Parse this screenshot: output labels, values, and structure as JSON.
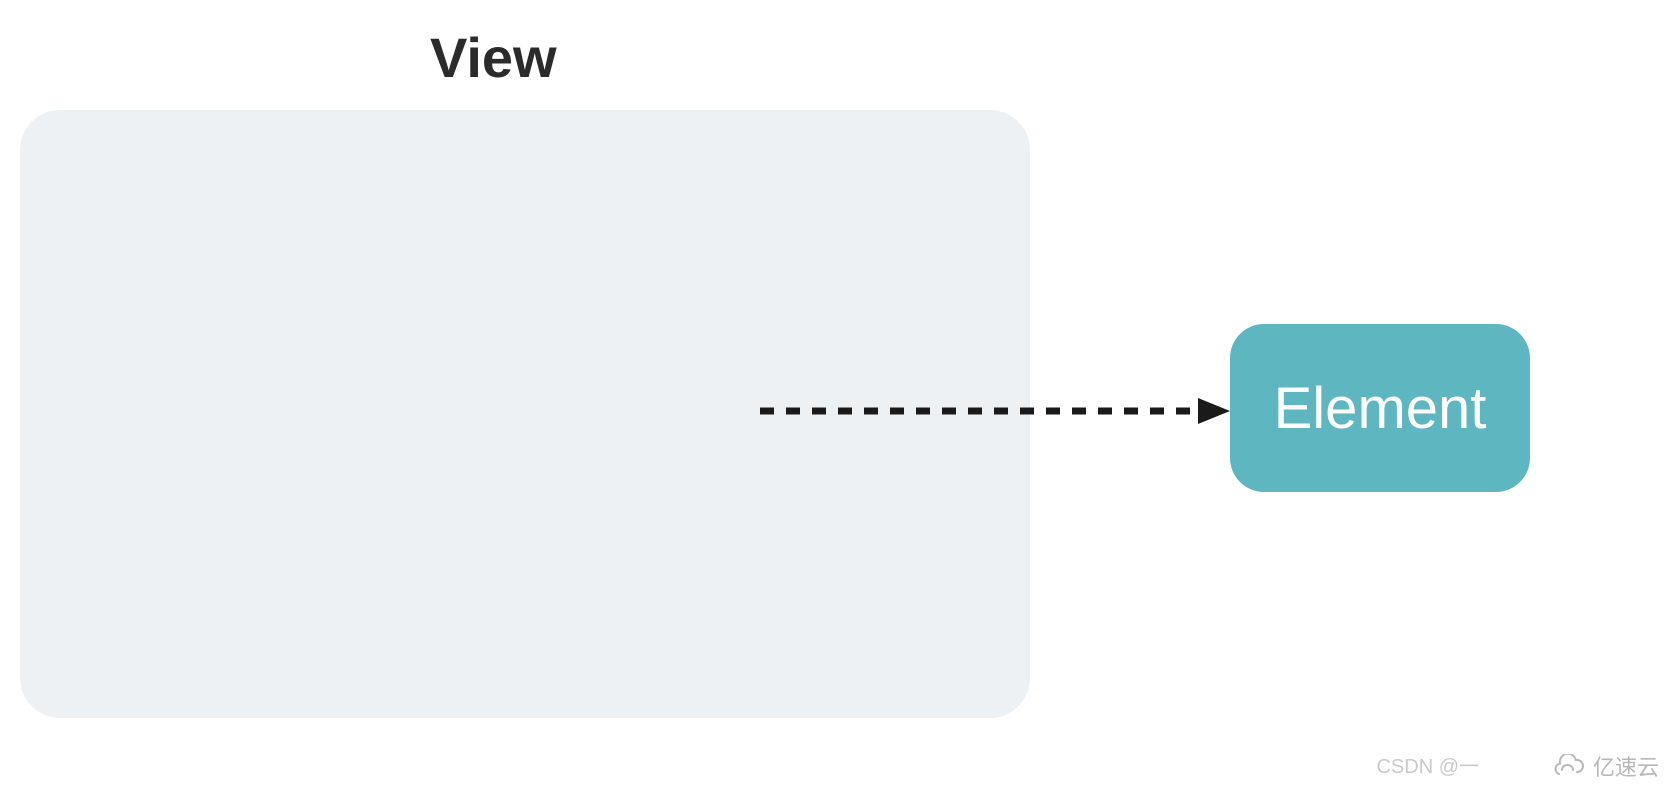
{
  "diagram": {
    "title": "View",
    "element_label": "Element"
  },
  "watermark": {
    "left_text": "CSDN @一",
    "right_text": "亿速云"
  },
  "colors": {
    "view_box_bg": "#edf1f4",
    "element_bg": "#5eb7c0",
    "element_text": "#ffffff",
    "title_text": "#2b2b2b",
    "arrow": "#1a1a1a",
    "watermark": "#b7b7b7"
  }
}
